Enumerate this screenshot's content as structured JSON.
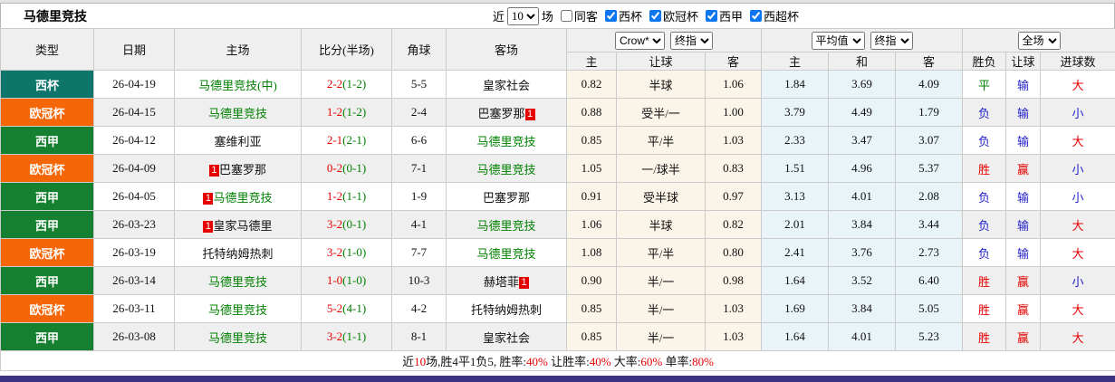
{
  "title": "马德里竞技",
  "controls": {
    "recent_label": "近",
    "recent_value": "10",
    "matches_label": "场",
    "same_away": {
      "label": "同客",
      "checked": false
    },
    "leagues": [
      {
        "label": "西杯",
        "checked": true
      },
      {
        "label": "欧冠杯",
        "checked": true
      },
      {
        "label": "西甲",
        "checked": true
      },
      {
        "label": "西超杯",
        "checked": true
      }
    ]
  },
  "header": {
    "cols": {
      "type": "类型",
      "date": "日期",
      "home": "主场",
      "score": "比分(半场)",
      "corners": "角球",
      "away": "客场"
    },
    "selects": {
      "bookmaker": "Crow*",
      "bookmaker_stage": "终指",
      "average": "平均值",
      "average_stage": "终指",
      "scope": "全场"
    },
    "odds_cols": [
      "主",
      "让球",
      "客",
      "主",
      "和",
      "客",
      "胜负",
      "让球",
      "进球数"
    ]
  },
  "rows": [
    {
      "type": "西杯",
      "date": "26-04-19",
      "home": {
        "name": "马德里竞技(中)",
        "green": true,
        "badge": null
      },
      "score": {
        "ft": "2-2",
        "ht": "(1-2)"
      },
      "corners": "5-5",
      "away": {
        "name": "皇家社会",
        "green": false,
        "badge": null
      },
      "crow": [
        "0.82",
        "半球",
        "1.06"
      ],
      "avg": [
        "1.84",
        "3.69",
        "4.09"
      ],
      "results": [
        {
          "t": "平",
          "c": "green"
        },
        {
          "t": "输",
          "c": "blue"
        },
        {
          "t": "大",
          "c": "red"
        }
      ]
    },
    {
      "type": "欧冠杯",
      "date": "26-04-15",
      "home": {
        "name": "马德里竞技",
        "green": true,
        "badge": null
      },
      "score": {
        "ft": "1-2",
        "ht": "(1-2)"
      },
      "corners": "2-4",
      "away": {
        "name": "巴塞罗那",
        "green": false,
        "badge": "after"
      },
      "crow": [
        "0.88",
        "受半/一",
        "1.00"
      ],
      "avg": [
        "3.79",
        "4.49",
        "1.79"
      ],
      "results": [
        {
          "t": "负",
          "c": "blue"
        },
        {
          "t": "输",
          "c": "blue"
        },
        {
          "t": "小",
          "c": "blue"
        }
      ]
    },
    {
      "type": "西甲",
      "date": "26-04-12",
      "home": {
        "name": "塞维利亚",
        "green": false,
        "badge": null
      },
      "score": {
        "ft": "2-1",
        "ht": "(2-1)"
      },
      "corners": "6-6",
      "away": {
        "name": "马德里竞技",
        "green": true,
        "badge": null
      },
      "crow": [
        "0.85",
        "平/半",
        "1.03"
      ],
      "avg": [
        "2.33",
        "3.47",
        "3.07"
      ],
      "results": [
        {
          "t": "负",
          "c": "blue"
        },
        {
          "t": "输",
          "c": "blue"
        },
        {
          "t": "大",
          "c": "red"
        }
      ]
    },
    {
      "type": "欧冠杯",
      "date": "26-04-09",
      "home": {
        "name": "巴塞罗那",
        "green": false,
        "badge": "before"
      },
      "score": {
        "ft": "0-2",
        "ht": "(0-1)"
      },
      "corners": "7-1",
      "away": {
        "name": "马德里竞技",
        "green": true,
        "badge": null
      },
      "crow": [
        "1.05",
        "一/球半",
        "0.83"
      ],
      "avg": [
        "1.51",
        "4.96",
        "5.37"
      ],
      "results": [
        {
          "t": "胜",
          "c": "red"
        },
        {
          "t": "赢",
          "c": "red"
        },
        {
          "t": "小",
          "c": "blue"
        }
      ]
    },
    {
      "type": "西甲",
      "date": "26-04-05",
      "home": {
        "name": "马德里竞技",
        "green": true,
        "badge": "before"
      },
      "score": {
        "ft": "1-2",
        "ht": "(1-1)"
      },
      "corners": "1-9",
      "away": {
        "name": "巴塞罗那",
        "green": false,
        "badge": null
      },
      "crow": [
        "0.91",
        "受半球",
        "0.97"
      ],
      "avg": [
        "3.13",
        "4.01",
        "2.08"
      ],
      "results": [
        {
          "t": "负",
          "c": "blue"
        },
        {
          "t": "输",
          "c": "blue"
        },
        {
          "t": "小",
          "c": "blue"
        }
      ]
    },
    {
      "type": "西甲",
      "date": "26-03-23",
      "home": {
        "name": "皇家马德里",
        "green": false,
        "badge": "before"
      },
      "score": {
        "ft": "3-2",
        "ht": "(0-1)"
      },
      "corners": "4-1",
      "away": {
        "name": "马德里竞技",
        "green": true,
        "badge": null
      },
      "crow": [
        "1.06",
        "半球",
        "0.82"
      ],
      "avg": [
        "2.01",
        "3.84",
        "3.44"
      ],
      "results": [
        {
          "t": "负",
          "c": "blue"
        },
        {
          "t": "输",
          "c": "blue"
        },
        {
          "t": "大",
          "c": "red"
        }
      ]
    },
    {
      "type": "欧冠杯",
      "date": "26-03-19",
      "home": {
        "name": "托特纳姆热刺",
        "green": false,
        "badge": null
      },
      "score": {
        "ft": "3-2",
        "ht": "(1-0)"
      },
      "corners": "7-7",
      "away": {
        "name": "马德里竞技",
        "green": true,
        "badge": null
      },
      "crow": [
        "1.08",
        "平/半",
        "0.80"
      ],
      "avg": [
        "2.41",
        "3.76",
        "2.73"
      ],
      "results": [
        {
          "t": "负",
          "c": "blue"
        },
        {
          "t": "输",
          "c": "blue"
        },
        {
          "t": "大",
          "c": "red"
        }
      ]
    },
    {
      "type": "西甲",
      "date": "26-03-14",
      "home": {
        "name": "马德里竞技",
        "green": true,
        "badge": null
      },
      "score": {
        "ft": "1-0",
        "ht": "(1-0)"
      },
      "corners": "10-3",
      "away": {
        "name": "赫塔菲",
        "green": false,
        "badge": "after"
      },
      "crow": [
        "0.90",
        "半/一",
        "0.98"
      ],
      "avg": [
        "1.64",
        "3.52",
        "6.40"
      ],
      "results": [
        {
          "t": "胜",
          "c": "red"
        },
        {
          "t": "赢",
          "c": "red"
        },
        {
          "t": "小",
          "c": "blue"
        }
      ]
    },
    {
      "type": "欧冠杯",
      "date": "26-03-11",
      "home": {
        "name": "马德里竞技",
        "green": true,
        "badge": null
      },
      "score": {
        "ft": "5-2",
        "ht": "(4-1)"
      },
      "corners": "4-2",
      "away": {
        "name": "托特纳姆热刺",
        "green": false,
        "badge": null
      },
      "crow": [
        "0.85",
        "半/一",
        "1.03"
      ],
      "avg": [
        "1.69",
        "3.84",
        "5.05"
      ],
      "results": [
        {
          "t": "胜",
          "c": "red"
        },
        {
          "t": "赢",
          "c": "red"
        },
        {
          "t": "大",
          "c": "red"
        }
      ]
    },
    {
      "type": "西甲",
      "date": "26-03-08",
      "home": {
        "name": "马德里竞技",
        "green": true,
        "badge": null
      },
      "score": {
        "ft": "3-2",
        "ht": "(1-1)"
      },
      "corners": "8-1",
      "away": {
        "name": "皇家社会",
        "green": false,
        "badge": null
      },
      "crow": [
        "0.85",
        "半/一",
        "1.03"
      ],
      "avg": [
        "1.64",
        "4.01",
        "5.23"
      ],
      "results": [
        {
          "t": "胜",
          "c": "red"
        },
        {
          "t": "赢",
          "c": "red"
        },
        {
          "t": "大",
          "c": "red"
        }
      ]
    }
  ],
  "footer": {
    "segments": [
      {
        "t": "近",
        "c": "black"
      },
      {
        "t": "10",
        "c": "red"
      },
      {
        "t": "场,胜4平1负5, 胜率:",
        "c": "black"
      },
      {
        "t": "40%",
        "c": "red"
      },
      {
        "t": " 让胜率:",
        "c": "black"
      },
      {
        "t": "40%",
        "c": "red"
      },
      {
        "t": " 大率:",
        "c": "black"
      },
      {
        "t": "60%",
        "c": "red"
      },
      {
        "t": " 单率:",
        "c": "black"
      },
      {
        "t": "80%",
        "c": "red"
      }
    ]
  },
  "colors": {
    "league_badges": {
      "西杯": "#0E756A",
      "欧冠杯": "#F56607",
      "西甲": "#168031"
    },
    "score_fulltime": "#E60000",
    "score_halftime": "#008000",
    "team_highlight": "#008000",
    "result_red": "#E60000",
    "result_blue": "#2222CC",
    "result_green": "#008000",
    "crow_cell_bg": "#FBF4E8",
    "avg_cell_bg": "#E9F4F9",
    "stripe_bg": "#EFEFEF",
    "checkbox_accent": "#0B76F0",
    "bottom_bar": "#3A3185"
  }
}
